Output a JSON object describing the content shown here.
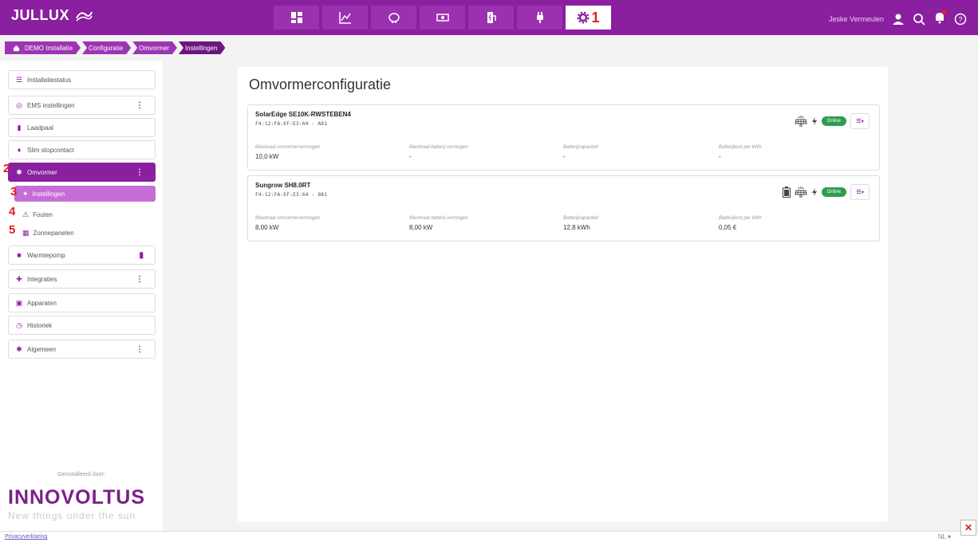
{
  "app": {
    "logo": "JULLUX",
    "user": "Jeske Vermeulen"
  },
  "nav": {
    "active_number": "1"
  },
  "breadcrumb": [
    "DEMO Installatie",
    "Configuratie",
    "Omvormer",
    "Instellingen"
  ],
  "sidebar": {
    "items": [
      {
        "label": "Installatiestatus"
      },
      {
        "label": "EMS instellingen"
      },
      {
        "label": "Laadpaal"
      },
      {
        "label": "Slim stopcontact"
      },
      {
        "label": "Omvormer"
      },
      {
        "label": "Warmtepomp"
      },
      {
        "label": "Integraties"
      },
      {
        "label": "Apparaten"
      },
      {
        "label": "Historiek"
      },
      {
        "label": "Algemeen"
      }
    ],
    "subitems": [
      {
        "label": "Instellingen"
      },
      {
        "label": "Fouten"
      },
      {
        "label": "Zonnepanelen"
      }
    ],
    "markers": [
      "2",
      "3",
      "4",
      "5"
    ],
    "installed_by": "Geïnstalleerd door:",
    "brand": "INNOVOLTUS",
    "tagline": "New things under the sun"
  },
  "main": {
    "title": "Omvormerconfiguratie",
    "cards": [
      {
        "name": "SolarEdge SE10K-RWSTEBEN4",
        "id": "F4:12:FA:EF:E3:64 - A81",
        "status": "Online",
        "fields": [
          {
            "label": "Maximaal omvormervermogen",
            "value": "10,0 kW"
          },
          {
            "label": "Maximaal batterij vermogen",
            "value": "-"
          },
          {
            "label": "Batterijcapaciteit",
            "value": "-"
          },
          {
            "label": "Batterijkost per kWh",
            "value": "-"
          }
        ]
      },
      {
        "name": "Sungrow SH8.0RT",
        "id": "F4:12:FA:EF:E3:64 - 881",
        "status": "Online",
        "fields": [
          {
            "label": "Maximaal omvormervermogen",
            "value": "8,00 kW"
          },
          {
            "label": "Maximaal batterij vermogen",
            "value": "8,00 kW"
          },
          {
            "label": "Batterijcapaciteit",
            "value": "12,8 kWh"
          },
          {
            "label": "Batterijkost per kWh",
            "value": "0,05 €"
          }
        ]
      }
    ]
  },
  "footer": {
    "privacy": "Privacyverklaring",
    "lang": "NL"
  },
  "colors": {
    "brand": "#8a1fa0",
    "online": "#2e9e4e",
    "marker": "#e02020"
  }
}
